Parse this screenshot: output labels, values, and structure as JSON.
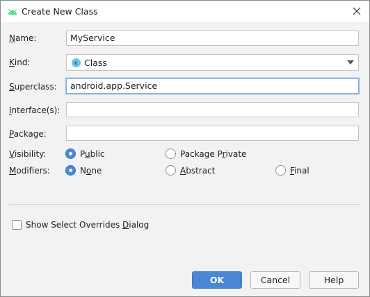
{
  "window": {
    "title": "Create New Class",
    "app_icon": "android-icon",
    "close_icon": "close-icon"
  },
  "fields": {
    "name": {
      "label_mnemonic": "N",
      "label_rest": "ame:",
      "value": "MyService"
    },
    "kind": {
      "label_mnemonic": "K",
      "label_rest": "ind:",
      "value": "Class",
      "icon_letter": "c"
    },
    "superclass": {
      "label_mnemonic": "S",
      "label_rest": "uperclass:",
      "value": "android.app.Service"
    },
    "interfaces": {
      "label_mnemonic": "I",
      "label_rest": "nterface(s):",
      "value": ""
    },
    "package": {
      "label_mnemonic": "P",
      "label_rest": "ackage:",
      "value": ""
    }
  },
  "visibility": {
    "label_mnemonic": "V",
    "label_rest": "isibility:",
    "options": [
      {
        "before": "P",
        "mnemonic": "u",
        "after": "blic",
        "checked": true
      },
      {
        "before": "Package P",
        "mnemonic": "r",
        "after": "ivate",
        "checked": false
      }
    ]
  },
  "modifiers": {
    "label_mnemonic": "M",
    "label_rest": "odifiers:",
    "options": [
      {
        "before": "N",
        "mnemonic": "o",
        "after": "ne",
        "checked": true
      },
      {
        "before": "",
        "mnemonic": "A",
        "after": "bstract",
        "checked": false
      },
      {
        "before": "",
        "mnemonic": "F",
        "after": "inal",
        "checked": false
      }
    ]
  },
  "overrides_checkbox": {
    "before": "Show Select Overrides ",
    "mnemonic": "D",
    "after": "ialog",
    "checked": false
  },
  "buttons": {
    "ok": "OK",
    "cancel": "Cancel",
    "help": "Help"
  },
  "colors": {
    "accent": "#4a87d6",
    "focus_border": "#87afda",
    "android_green": "#3ddc84"
  }
}
